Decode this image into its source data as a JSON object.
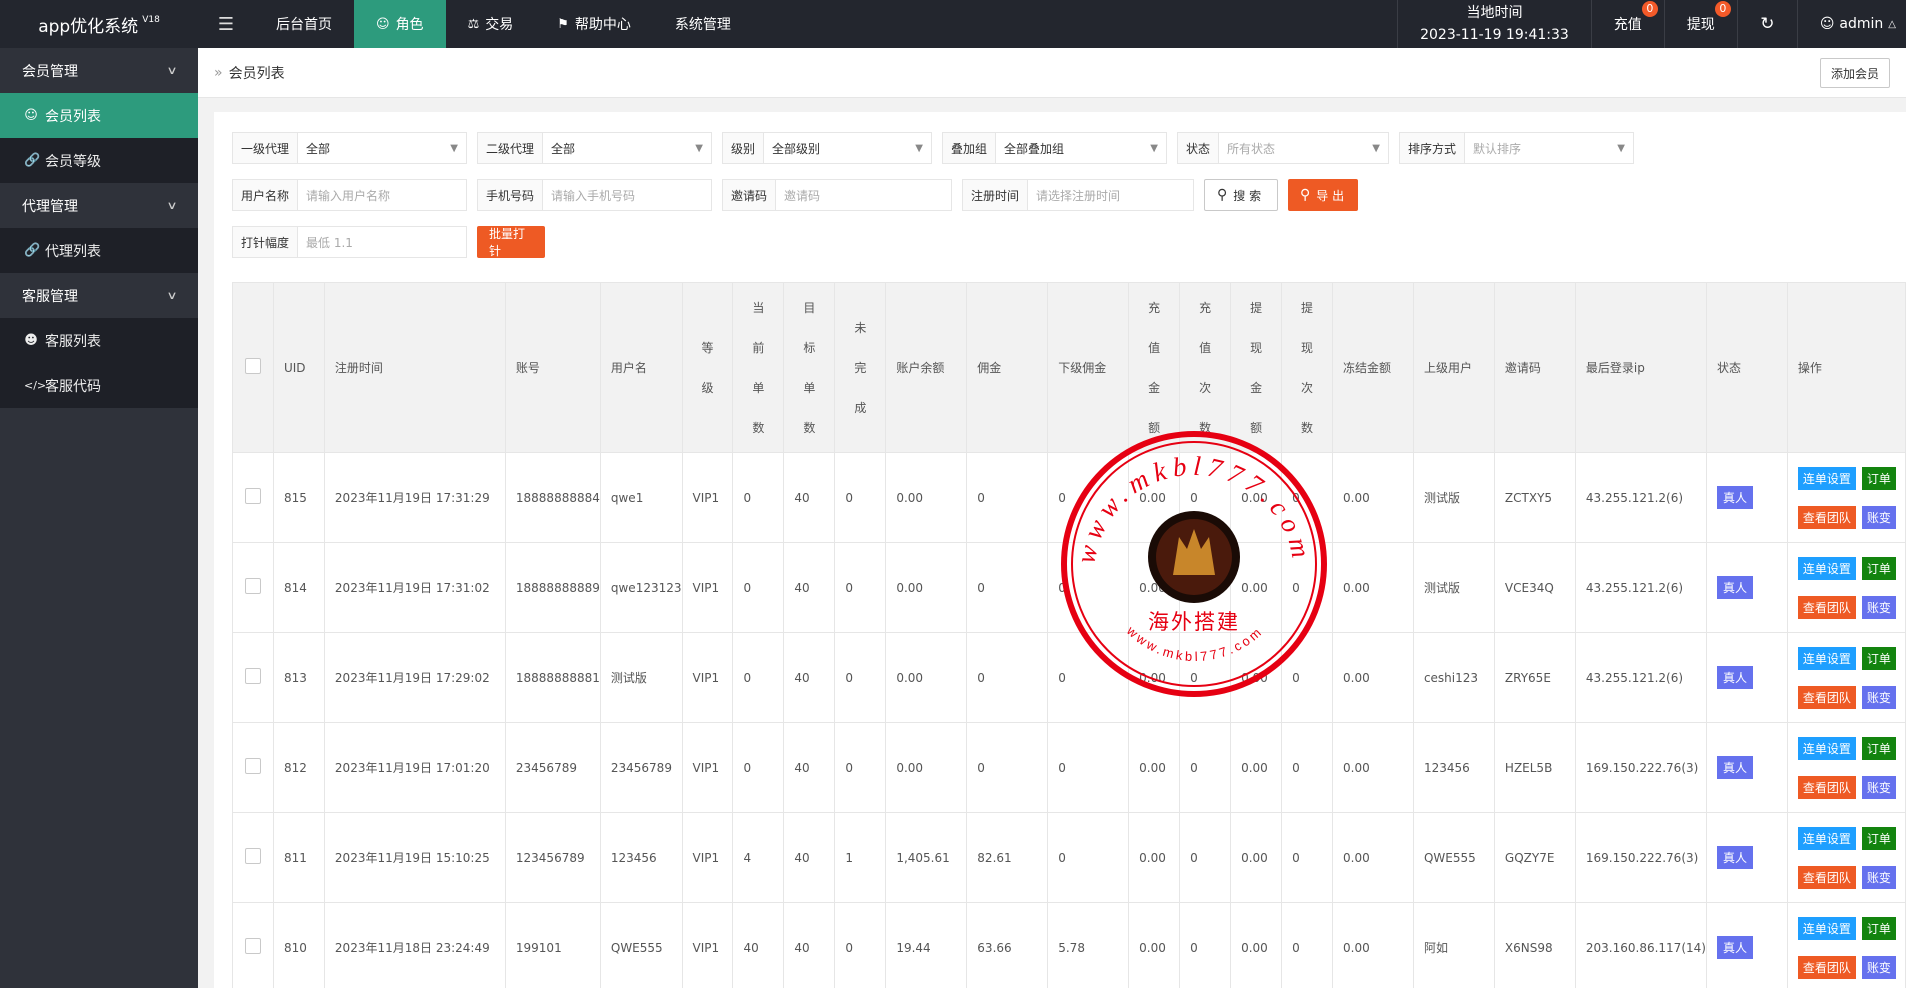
{
  "app": {
    "title": "app优化系统",
    "version": "V18"
  },
  "topnav": [
    {
      "label": "后台首页",
      "icon": ""
    },
    {
      "label": "角色",
      "icon": "user-icon",
      "active": true
    },
    {
      "label": "交易",
      "icon": "scale-icon"
    },
    {
      "label": "帮助中心",
      "icon": "flag-icon"
    },
    {
      "label": "系统管理",
      "icon": ""
    }
  ],
  "header_right": {
    "time_label": "当地时间",
    "time_value": "2023-11-19 19:41:33",
    "recharge_label": "充值",
    "recharge_badge": "0",
    "withdraw_label": "提现",
    "withdraw_badge": "0",
    "user": "admin"
  },
  "sidebar": {
    "group1": "会员管理",
    "item1": "会员列表",
    "item2": "会员等级",
    "group2": "代理管理",
    "item3": "代理列表",
    "group3": "客服管理",
    "item4": "客服列表",
    "item5": "客服代码"
  },
  "breadcrumb": "会员列表",
  "add_button": "添加会员",
  "filters": {
    "agent1_label": "一级代理",
    "agent1_value": "全部",
    "agent2_label": "二级代理",
    "agent2_value": "全部",
    "level_label": "级别",
    "level_value": "全部级别",
    "stack_label": "叠加组",
    "stack_value": "全部叠加组",
    "status_label": "状态",
    "status_value": "所有状态",
    "sort_label": "排序方式",
    "sort_value": "默认排序",
    "username_label": "用户名称",
    "username_ph": "请输入用户名称",
    "phone_label": "手机号码",
    "phone_ph": "请输入手机号码",
    "invite_label": "邀请码",
    "invite_ph": "邀请码",
    "regtime_label": "注册时间",
    "regtime_ph": "请选择注册时间",
    "search_btn": "搜 索",
    "export_btn": "导 出",
    "hit_label": "打针幅度",
    "hit_ph": "最低 1.1",
    "batch_btn": "批量打针"
  },
  "table": {
    "headers": {
      "uid": "UID",
      "regtime": "注册时间",
      "account": "账号",
      "username": "用户名",
      "level": "等级",
      "cur_orders": "当前单数",
      "target_orders": "目标单数",
      "unfinished": "未完成",
      "balance": "账户余额",
      "commission": "佣金",
      "sub_commission": "下级佣金",
      "recharge_amount": "充值金额",
      "recharge_count": "充值次数",
      "withdraw_amount": "提现金额",
      "withdraw_count": "提现次数",
      "frozen": "冻结金额",
      "parent": "上级用户",
      "invite": "邀请码",
      "last_ip": "最后登录ip",
      "status": "状态",
      "ops": "操作"
    },
    "ops_labels": {
      "set": "连单设置",
      "order": "订单",
      "team": "查看团队",
      "account": "账变"
    },
    "rows": [
      {
        "uid": "815",
        "regtime": "2023年11月19日 17:31:29",
        "account": "18888888884",
        "username": "qwe1",
        "level": "VIP1",
        "cur": "0",
        "target": "40",
        "unfinished": "0",
        "balance": "0.00",
        "commission": "0",
        "sub": "0",
        "ramount": "0.00",
        "rcount": "0",
        "wamount": "0.00",
        "wcount": "0",
        "frozen": "0.00",
        "parent": "测试版",
        "invite": "ZCTXY5",
        "ip": "43.255.121.2(6)",
        "status": "真人"
      },
      {
        "uid": "814",
        "regtime": "2023年11月19日 17:31:02",
        "account": "18888888889",
        "username": "qwe123123",
        "level": "VIP1",
        "cur": "0",
        "target": "40",
        "unfinished": "0",
        "balance": "0.00",
        "commission": "0",
        "sub": "0",
        "ramount": "0.00",
        "rcount": "0",
        "wamount": "0.00",
        "wcount": "0",
        "frozen": "0.00",
        "parent": "测试版",
        "invite": "VCE34Q",
        "ip": "43.255.121.2(6)",
        "status": "真人"
      },
      {
        "uid": "813",
        "regtime": "2023年11月19日 17:29:02",
        "account": "18888888881",
        "username": "测试版",
        "level": "VIP1",
        "cur": "0",
        "target": "40",
        "unfinished": "0",
        "balance": "0.00",
        "commission": "0",
        "sub": "0",
        "ramount": "0.00",
        "rcount": "0",
        "wamount": "0.00",
        "wcount": "0",
        "frozen": "0.00",
        "parent": "ceshi123",
        "invite": "ZRY65E",
        "ip": "43.255.121.2(6)",
        "status": "真人"
      },
      {
        "uid": "812",
        "regtime": "2023年11月19日 17:01:20",
        "account": "23456789",
        "username": "23456789",
        "level": "VIP1",
        "cur": "0",
        "target": "40",
        "unfinished": "0",
        "balance": "0.00",
        "commission": "0",
        "sub": "0",
        "ramount": "0.00",
        "rcount": "0",
        "wamount": "0.00",
        "wcount": "0",
        "frozen": "0.00",
        "parent": "123456",
        "invite": "HZEL5B",
        "ip": "169.150.222.76(3)",
        "status": "真人"
      },
      {
        "uid": "811",
        "regtime": "2023年11月19日 15:10:25",
        "account": "123456789",
        "username": "123456",
        "level": "VIP1",
        "cur": "4",
        "target": "40",
        "unfinished": "1",
        "balance": "1,405.61",
        "commission": "82.61",
        "sub": "0",
        "ramount": "0.00",
        "rcount": "0",
        "wamount": "0.00",
        "wcount": "0",
        "frozen": "0.00",
        "parent": "QWE555",
        "invite": "GQZY7E",
        "ip": "169.150.222.76(3)",
        "status": "真人"
      },
      {
        "uid": "810",
        "regtime": "2023年11月18日 23:24:49",
        "account": "199101",
        "username": "QWE555",
        "level": "VIP1",
        "cur": "40",
        "target": "40",
        "unfinished": "0",
        "balance": "19.44",
        "commission": "63.66",
        "sub": "5.78",
        "ramount": "0.00",
        "rcount": "0",
        "wamount": "0.00",
        "wcount": "0",
        "frozen": "0.00",
        "parent": "阿如",
        "invite": "X6NS98",
        "ip": "203.160.86.117(14)",
        "status": "真人"
      }
    ]
  },
  "stamp": {
    "url_text": "www.mkbl777.com",
    "caption": "海外搭建",
    "small_url": "www.mkbl777.com"
  },
  "colors": {
    "accent": "#2d9b7d",
    "topbar": "#23262e",
    "sidebar": "#2f323a",
    "orange": "#ee5a24",
    "stamp_red": "#e60012"
  }
}
